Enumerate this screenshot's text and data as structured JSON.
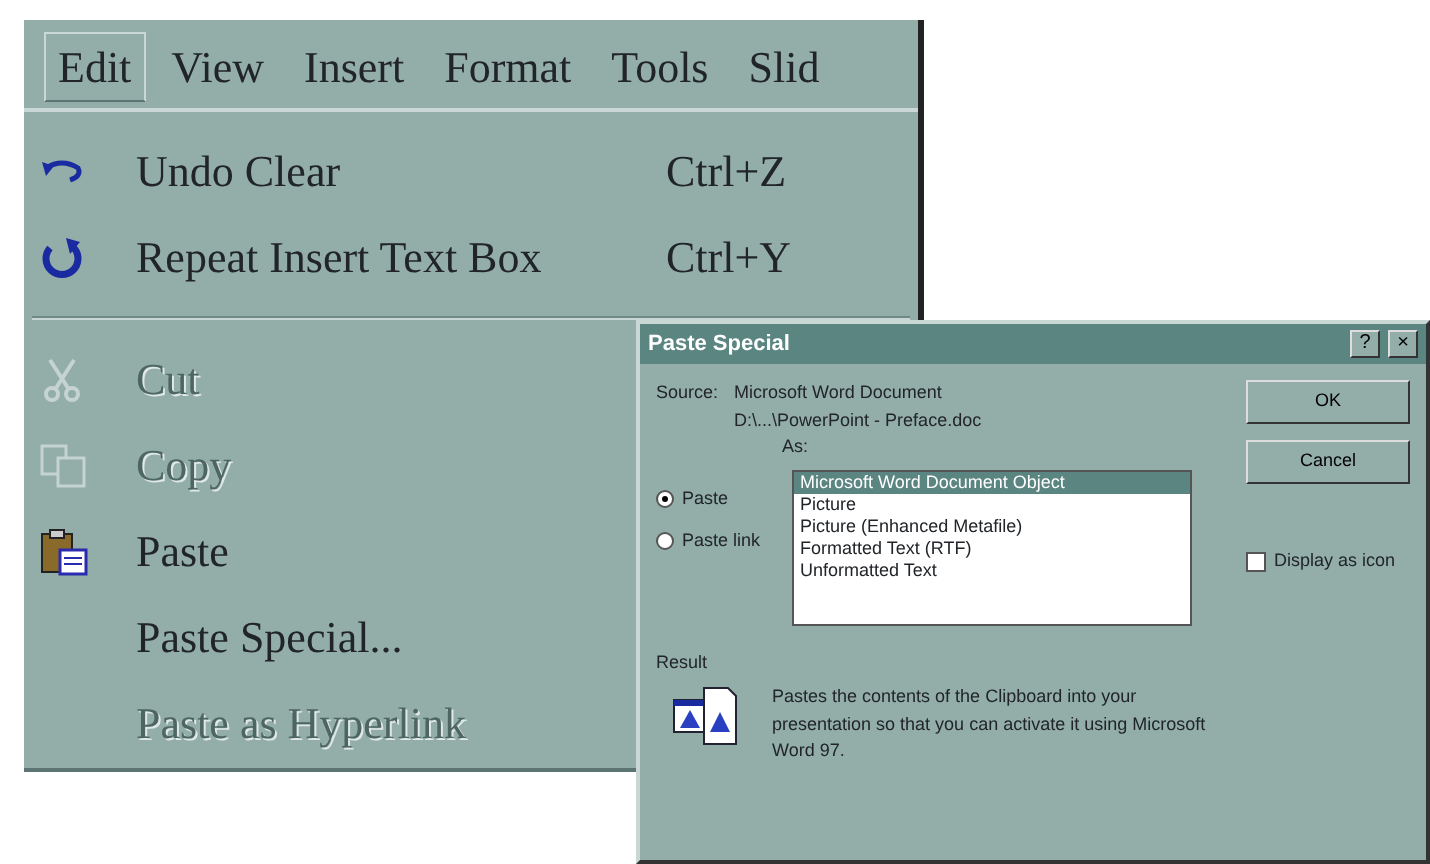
{
  "menu_bar": {
    "items": [
      {
        "label": "Edit",
        "selected": true
      },
      {
        "label": "View",
        "selected": false
      },
      {
        "label": "Insert",
        "selected": false
      },
      {
        "label": "Format",
        "selected": false
      },
      {
        "label": "Tools",
        "selected": false
      },
      {
        "label": "Slid",
        "selected": false
      }
    ]
  },
  "edit_menu": {
    "groups": [
      [
        {
          "label": "Undo Clear",
          "shortcut": "Ctrl+Z",
          "kind": "undo",
          "disabled": false
        },
        {
          "label": "Repeat Insert Text Box",
          "shortcut": "Ctrl+Y",
          "kind": "repeat",
          "disabled": false
        }
      ],
      [
        {
          "label": "Cut",
          "kind": "cut",
          "disabled": true
        },
        {
          "label": "Copy",
          "kind": "copy",
          "disabled": true
        },
        {
          "label": "Paste",
          "kind": "paste",
          "disabled": false
        },
        {
          "label": "Paste Special...",
          "disabled": false
        },
        {
          "label": "Paste as Hyperlink",
          "disabled": true
        }
      ]
    ]
  },
  "dialog": {
    "title": "Paste Special",
    "help": "?",
    "close": "×",
    "source_label": "Source:",
    "source_lines": [
      "Microsoft Word Document",
      "D:\\...\\PowerPoint - Preface.doc",
      "As:"
    ],
    "options": [
      {
        "label": "Paste",
        "selected": true
      },
      {
        "label": "Paste link",
        "selected": false
      }
    ],
    "formats": [
      {
        "label": "Microsoft Word Document Object",
        "selected": true
      },
      {
        "label": "Picture",
        "selected": false
      },
      {
        "label": "Picture (Enhanced Metafile)",
        "selected": false
      },
      {
        "label": "Formatted Text (RTF)",
        "selected": false
      },
      {
        "label": "Unformatted Text",
        "selected": false
      }
    ],
    "buttons": [
      "OK",
      "Cancel"
    ],
    "display_as_icon": {
      "label": "Display as icon",
      "checked": false
    },
    "result_label": "Result",
    "result_text": "Pastes the contents of the Clipboard into your presentation so that you can activate it using Microsoft Word 97."
  }
}
